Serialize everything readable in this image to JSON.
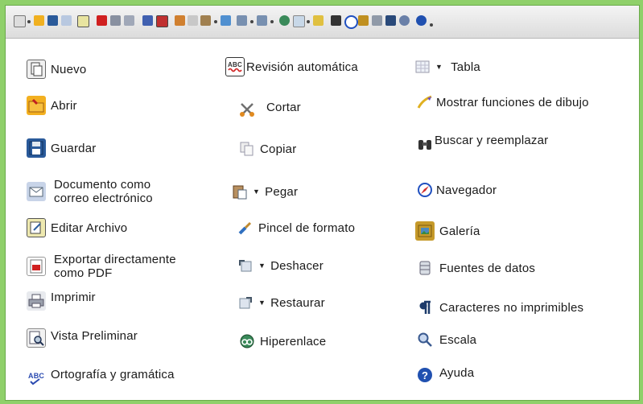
{
  "colors": {
    "background": "#8fd06a",
    "panel": "#ffffff",
    "toolbar": "#e6e6e6"
  },
  "columns": [
    {
      "items": [
        {
          "label": "Nuevo",
          "icon": "new-document-icon"
        },
        {
          "label": "Abrir",
          "icon": "open-folder-icon"
        },
        {
          "label": "Guardar",
          "icon": "save-disk-icon"
        },
        {
          "label": "Documento como\ncorreo electrónico",
          "icon": "email-document-icon"
        },
        {
          "label": "Editar Archivo",
          "icon": "edit-file-icon"
        },
        {
          "label": "Exportar directamente\ncomo PDF",
          "icon": "pdf-export-icon"
        },
        {
          "label": "Imprimir",
          "icon": "printer-icon"
        },
        {
          "label": "Vista Preliminar",
          "icon": "print-preview-icon"
        },
        {
          "label": "Ortografía y gramática",
          "icon": "spellcheck-icon"
        }
      ]
    },
    {
      "items": [
        {
          "label": "Revisión automática",
          "icon": "auto-spellcheck-icon"
        },
        {
          "label": "Cortar",
          "icon": "scissors-icon"
        },
        {
          "label": "Copiar",
          "icon": "copy-icon"
        },
        {
          "label": "Pegar",
          "icon": "paste-icon",
          "dropdown": true
        },
        {
          "label": "Pincel de formato",
          "icon": "format-paintbrush-icon"
        },
        {
          "label": "Deshacer",
          "icon": "undo-icon",
          "dropdown": true
        },
        {
          "label": "Restaurar",
          "icon": "redo-icon",
          "dropdown": true
        },
        {
          "label": "Hiperenlace",
          "icon": "hyperlink-globe-icon"
        }
      ]
    },
    {
      "items": [
        {
          "label": "Tabla",
          "icon": "table-icon",
          "dropdown": true
        },
        {
          "label": "Mostrar funciones de dibujo",
          "icon": "drawing-pencil-icon"
        },
        {
          "label": "Buscar y reemplazar",
          "icon": "binoculars-icon"
        },
        {
          "label": "Navegador",
          "icon": "navigator-compass-icon"
        },
        {
          "label": "Galería",
          "icon": "gallery-image-icon"
        },
        {
          "label": "Fuentes de datos",
          "icon": "data-sources-icon"
        },
        {
          "label": "Caracteres no imprimibles",
          "icon": "pilcrow-icon"
        },
        {
          "label": "Escala",
          "icon": "zoom-magnifier-icon"
        },
        {
          "label": "Ayuda",
          "icon": "help-icon"
        }
      ]
    }
  ]
}
